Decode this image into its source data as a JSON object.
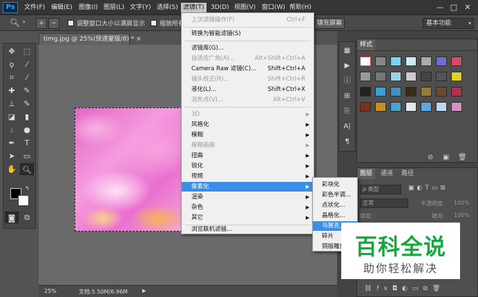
{
  "app": {
    "logo": "Ps"
  },
  "menubar": {
    "items": [
      "文件(F)",
      "编辑(E)",
      "图像(I)",
      "图层(L)",
      "文字(Y)",
      "选择(S)",
      "滤镜(T)",
      "3D(D)",
      "视图(V)",
      "窗口(W)",
      "帮助(H)"
    ],
    "active_index": 6
  },
  "window_controls": {
    "minimize": "—",
    "maximize": "□",
    "close": "✕"
  },
  "options_bar": {
    "check1_label": "调整窗口大小以满屏显示",
    "check2_label": "缩放所有",
    "fill_screen": "填充屏幕",
    "workspace": "基本功能"
  },
  "document": {
    "tab_label": "timg.jpg @ 25%(快速蒙版/8) *",
    "tab_close": "×"
  },
  "status": {
    "zoom": "25%",
    "doc_size": "文档:5.50M/6.96M"
  },
  "filter_menu": {
    "last_filter": {
      "label": "上次滤镜操作(F)",
      "shortcut": "Ctrl+F"
    },
    "smart": "转换为智能滤镜(S)",
    "gallery": "滤镜库(G)...",
    "adaptive": {
      "label": "自适应广角(A)...",
      "shortcut": "Alt+Shift+Ctrl+A"
    },
    "camera_raw": {
      "label": "Camera Raw 滤镜(C)...",
      "shortcut": "Shift+Ctrl+A"
    },
    "lens": {
      "label": "镜头校正(R)...",
      "shortcut": "Shift+Ctrl+R"
    },
    "liquify": {
      "label": "液化(L)...",
      "shortcut": "Shift+Ctrl+X"
    },
    "vanishing": {
      "label": "消失点(V)...",
      "shortcut": "Alt+Ctrl+V"
    },
    "groups": [
      "3D",
      "风格化",
      "模糊",
      "模糊画廊",
      "扭曲",
      "锐化",
      "视频",
      "像素化",
      "渲染",
      "杂色",
      "其它"
    ],
    "browse": "浏览联机滤镜..."
  },
  "pixelate_submenu": {
    "items": [
      "彩块化",
      "彩色半调...",
      "点状化...",
      "晶格化...",
      "马赛克...",
      "碎片",
      "铜版雕刻..."
    ],
    "highlight_index": 4
  },
  "panels": {
    "styles": {
      "title": "样式"
    },
    "layers": {
      "tabs": [
        "图层",
        "通道",
        "路径"
      ],
      "kind": "ρ 类型",
      "mode": "正常",
      "opacity_label": "不透明度:",
      "opacity": "100%",
      "lock_label": "锁定:",
      "fill_label": "填充:",
      "fill": "100%"
    }
  },
  "colors": {
    "accent": "#3a8ee6",
    "menubar": "#353535",
    "canvas": "#6a6a6a",
    "watermark": "#14a93b"
  },
  "watermark": {
    "title": "百科全说",
    "subtitle": "助你轻松解决"
  }
}
